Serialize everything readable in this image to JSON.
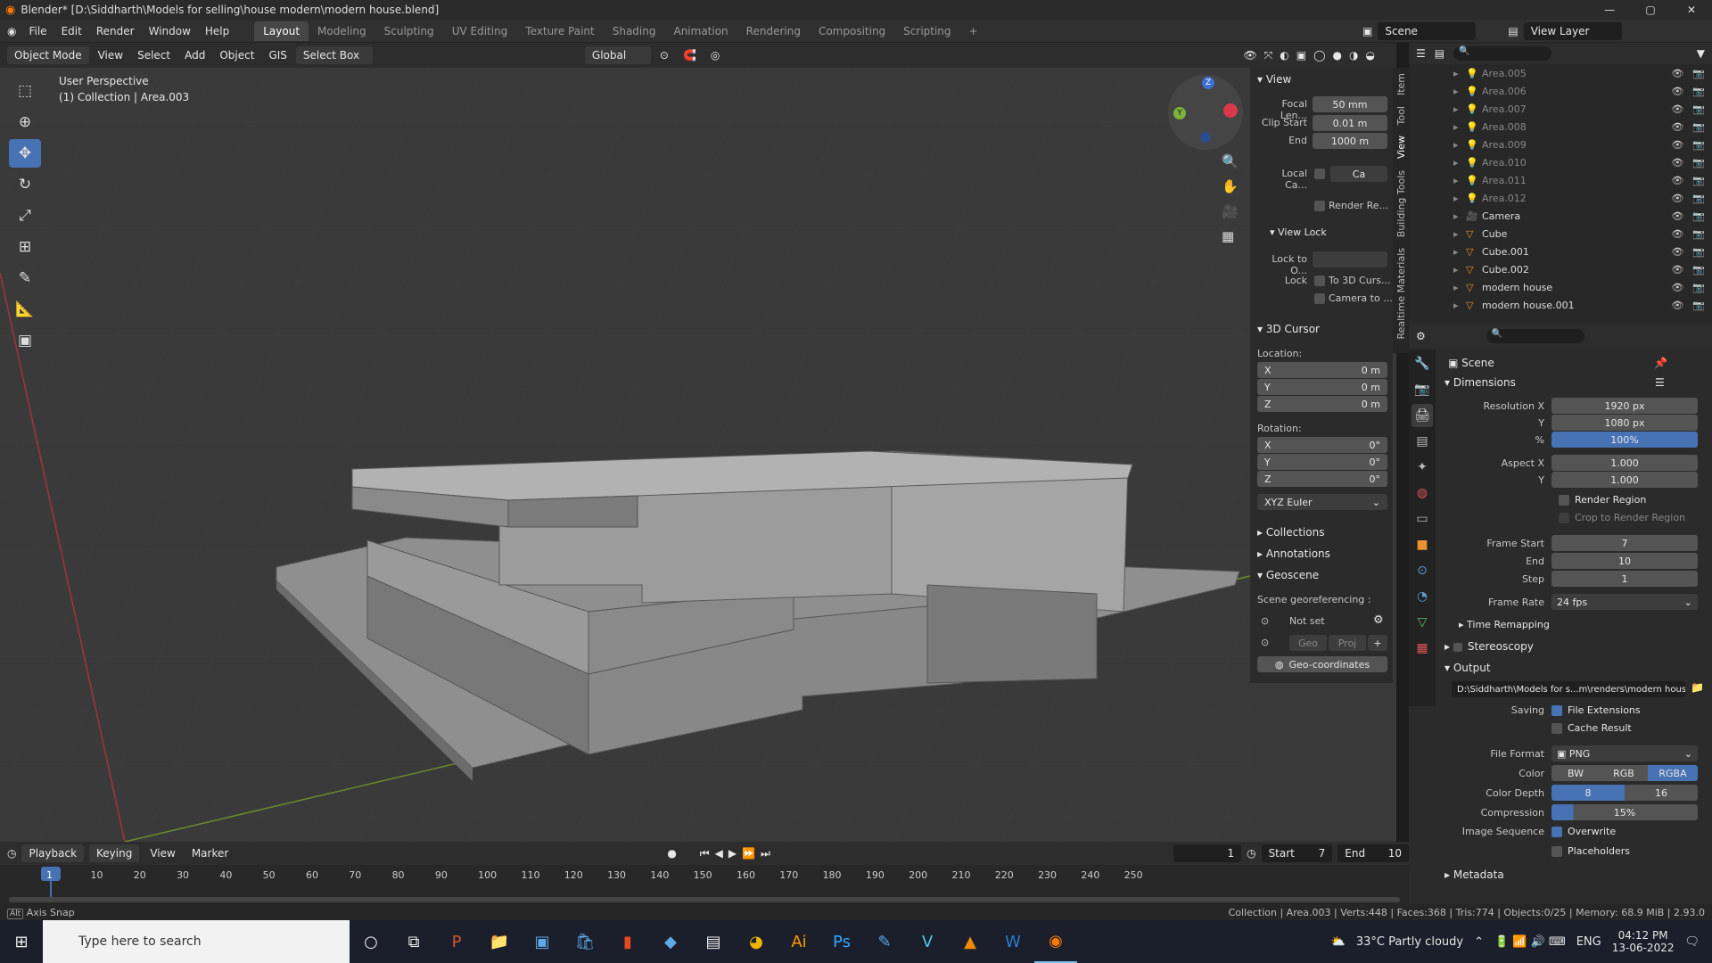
{
  "titlebar": {
    "title": "Blender* [D:\\Siddharth\\Models for selling\\house modern\\modern house.blend]",
    "min": "—",
    "max": "▢",
    "close": "✕"
  },
  "menubar": {
    "items": [
      "File",
      "Edit",
      "Render",
      "Window",
      "Help"
    ],
    "workspaces": [
      "Layout",
      "Modeling",
      "Sculpting",
      "UV Editing",
      "Texture Paint",
      "Shading",
      "Animation",
      "Rendering",
      "Compositing",
      "Scripting"
    ],
    "active_workspace": "Layout",
    "scene": "Scene",
    "view_layer": "View Layer",
    "add_ws": "+"
  },
  "vphead": {
    "mode": "Object Mode",
    "view": "View",
    "select": "Select",
    "add": "Add",
    "object": "Object",
    "gis": "GIS",
    "select_box": "Select Box",
    "transform": "Global"
  },
  "viewport": {
    "persp": "User Perspective",
    "collection": "(1) Collection | Area.003"
  },
  "npanel": {
    "view_section": "View",
    "focal_label": "Focal Len...",
    "focal": "50 mm",
    "clip_start_label": "Clip Start",
    "clip_start": "0.01 m",
    "end_label": "End",
    "clip_end": "1000 m",
    "local_cam_label": "Local Ca...",
    "local_cam_val": "Ca",
    "render_region": "Render Re...",
    "view_lock": "View Lock",
    "lock_to_label": "Lock to O...",
    "lock_label": "Lock",
    "to_3d_cursor": "To 3D Curs...",
    "camera_to": "Camera to ...",
    "cursor_section": "3D Cursor",
    "location_label": "Location:",
    "loc_x": "0 m",
    "loc_y": "0 m",
    "loc_z": "0 m",
    "rotation_label": "Rotation:",
    "rot_x": "0°",
    "rot_y": "0°",
    "rot_z": "0°",
    "axis_x": "X",
    "axis_y": "Y",
    "axis_z": "Z",
    "euler": "XYZ Euler",
    "collections": "Collections",
    "annotations": "Annotations",
    "geoscene": "Geoscene",
    "georef_label": "Scene georeferencing :",
    "not_set": "Not set",
    "geo": "Geo",
    "proj": "Proj",
    "plus": "+",
    "geo_coords": "Geo-coordinates"
  },
  "vtabs": [
    "Item",
    "Tool",
    "View",
    "Building Tools",
    "Realtime Materials"
  ],
  "outliner": {
    "rows": [
      "Area.005",
      "Area.006",
      "Area.007",
      "Area.008",
      "Area.009",
      "Area.010",
      "Area.011",
      "Area.012",
      "Camera",
      "Cube",
      "Cube.001",
      "Cube.002",
      "modern house",
      "modern house.001"
    ]
  },
  "props": {
    "scene": "Scene",
    "dimensions": "Dimensions",
    "res_x_label": "Resolution X",
    "res_x": "1920 px",
    "res_y_label": "Y",
    "res_y": "1080 px",
    "pct_label": "%",
    "pct": "100%",
    "aspect_x_label": "Aspect X",
    "aspect_x": "1.000",
    "aspect_y_label": "Y",
    "aspect_y": "1.000",
    "render_region": "Render Region",
    "crop": "Crop to Render Region",
    "frame_start_label": "Frame Start",
    "frame_start": "7",
    "end_label": "End",
    "frame_end": "10",
    "step_label": "Step",
    "step": "1",
    "frame_rate_label": "Frame Rate",
    "frame_rate": "24 fps",
    "time_remap": "Time Remapping",
    "stereo": "Stereoscopy",
    "output": "Output",
    "output_path": "D:\\Siddharth\\Models for s...m\\renders\\modern house",
    "saving_label": "Saving",
    "file_ext": "File Extensions",
    "cache": "Cache Result",
    "file_format_label": "File Format",
    "file_format": "PNG",
    "color_label": "Color",
    "bw": "BW",
    "rgb": "RGB",
    "rgba": "RGBA",
    "depth_label": "Color Depth",
    "d8": "8",
    "d16": "16",
    "compression_label": "Compression",
    "compression": "15%",
    "img_seq_label": "Image Sequence",
    "overwrite": "Overwrite",
    "placeholders": "Placeholders",
    "metadata": "Metadata"
  },
  "timeline": {
    "playback": "Playback",
    "keying": "Keying",
    "view": "View",
    "marker": "Marker",
    "current": "1",
    "start_label": "Start",
    "start": "7",
    "end_label": "End",
    "end": "10",
    "ticks": [
      "1",
      "10",
      "20",
      "30",
      "40",
      "50",
      "60",
      "70",
      "80",
      "90",
      "100",
      "110",
      "120",
      "130",
      "140",
      "150",
      "160",
      "170",
      "180",
      "190",
      "200",
      "210",
      "220",
      "230",
      "240",
      "250"
    ]
  },
  "status": {
    "left": "Axis Snap",
    "right": "Collection | Area.003 | Verts:448 | Faces:368 | Tris:774 | Objects:0/25 | Memory: 68.9 MiB | 2.93.0"
  },
  "taskbar": {
    "search": "Type here to search",
    "weather": "33°C  Partly cloudy",
    "lang": "ENG",
    "time": "04:12 PM",
    "date": "13-06-2022"
  }
}
